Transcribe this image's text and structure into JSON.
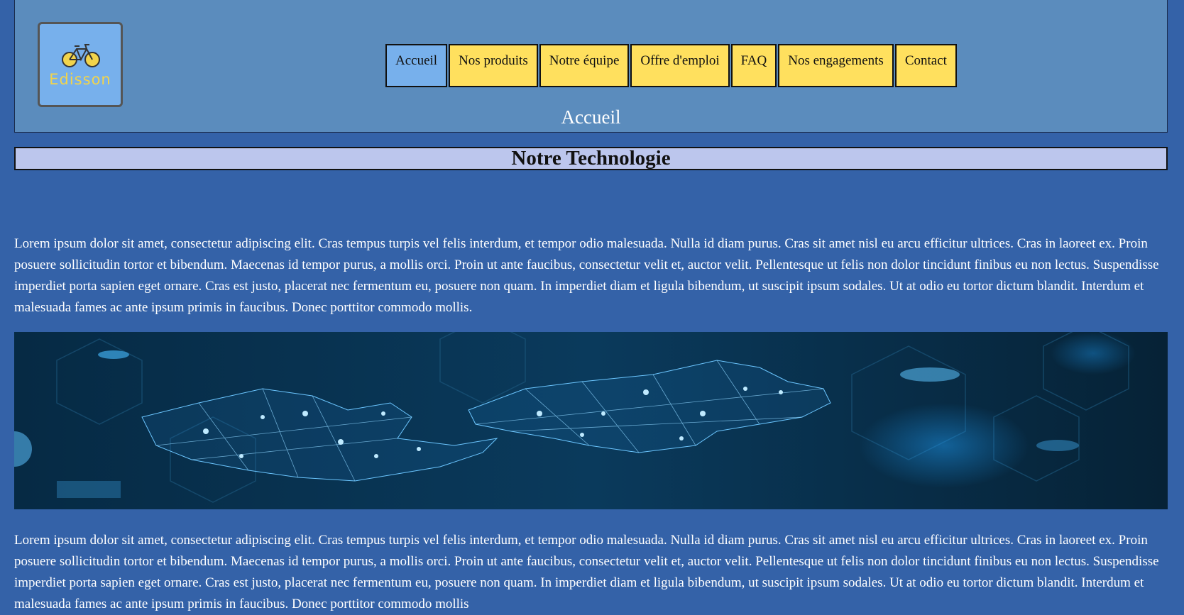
{
  "logo": {
    "text": "Edisson"
  },
  "nav": {
    "items": [
      "Accueil",
      "Nos produits",
      "Notre équipe",
      "Offre d'emploi",
      "FAQ",
      "Nos engagements",
      "Contact"
    ],
    "active": "Accueil"
  },
  "page_title": "Accueil",
  "section": {
    "title": "Notre Technologie",
    "paragraph1": "Lorem ipsum dolor sit amet, consectetur adipiscing elit. Cras tempus turpis vel felis interdum, et tempor odio malesuada. Nulla id diam purus. Cras sit amet nisl eu arcu efficitur ultrices. Cras in laoreet ex. Proin posuere sollicitudin tortor et bibendum. Maecenas id tempor purus, a mollis orci. Proin ut ante faucibus, consectetur velit et, auctor velit. Pellentesque ut felis non dolor tincidunt finibus eu non lectus. Suspendisse imperdiet porta sapien eget ornare. Cras est justo, placerat nec fermentum eu, posuere non quam. In imperdiet diam et ligula bibendum, ut suscipit ipsum sodales. Ut at odio eu tortor dictum blandit. Interdum et malesuada fames ac ante ipsum primis in faucibus. Donec porttitor commodo mollis.",
    "paragraph2": "Lorem ipsum dolor sit amet, consectetur adipiscing elit. Cras tempus turpis vel felis interdum, et tempor odio malesuada. Nulla id diam purus. Cras sit amet nisl eu arcu efficitur ultrices. Cras in laoreet ex. Proin posuere sollicitudin tortor et bibendum. Maecenas id tempor purus, a mollis orci. Proin ut ante faucibus, consectetur velit et, auctor velit. Pellentesque ut felis non dolor tincidunt finibus eu non lectus. Suspendisse imperdiet porta sapien eget ornare. Cras est justo, placerat nec fermentum eu, posuere non quam. In imperdiet diam et ligula bibendum, ut suscipit ipsum sodales. Ut at odio eu tortor dictum blandit. Interdum et malesuada fames ac ante ipsum primis in faucibus. Donec porttitor commodo mollis"
  },
  "colors": {
    "background": "#3462a8",
    "header": "#5b8cbd",
    "nav_item": "#ffe05e",
    "nav_active": "#77b0ec",
    "section_title_bg": "#bcc6ed",
    "logo_text": "#f2d44b"
  },
  "icons": {
    "logo": "bicycle-icon",
    "banner": "puzzle-network-image"
  }
}
